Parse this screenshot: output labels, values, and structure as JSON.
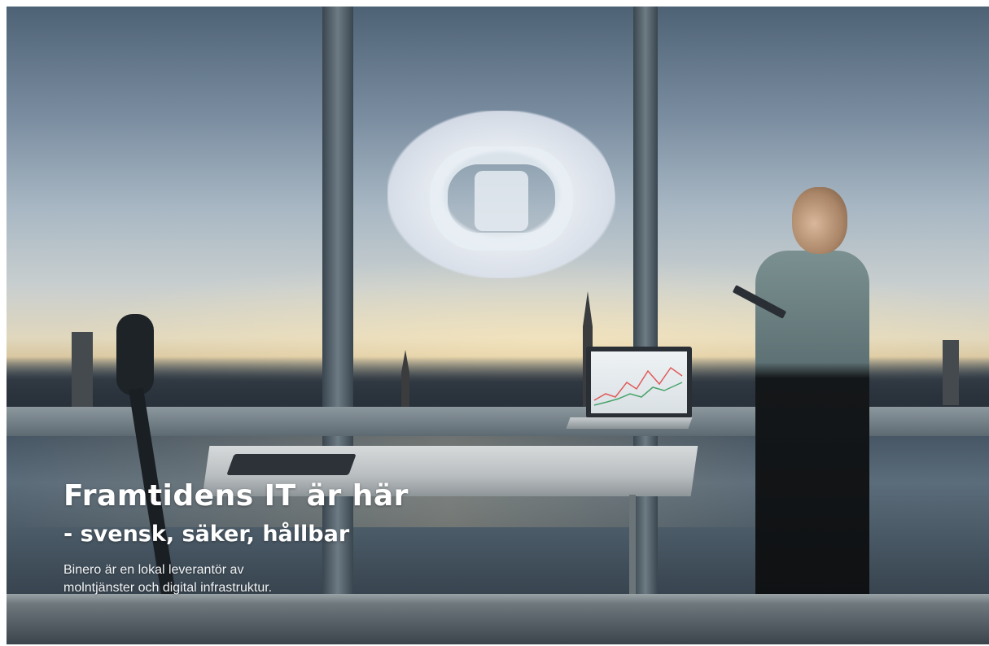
{
  "hero": {
    "title": "Framtidens IT är här",
    "subtitle": "- svensk, säker, hållbar",
    "text_line1": "Binero är en lokal leverantör av",
    "text_line2": "molntjänster och digital infrastruktur."
  },
  "colors": {
    "text": "#ffffff",
    "sky_top": "#4e6275",
    "horizon": "#e0d7bd"
  }
}
